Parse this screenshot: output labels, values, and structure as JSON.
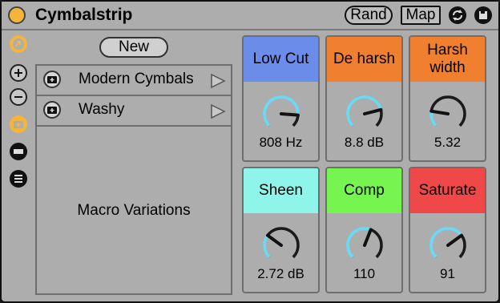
{
  "device": {
    "title": "Cymbalstrip",
    "rand_label": "Rand",
    "map_label": "Map",
    "power_color": "#f5b53a",
    "accent_color": "#f5b53a"
  },
  "sidebar": {
    "icons": [
      "hot-swap-icon",
      "add-icon",
      "remove-icon",
      "snapshot-icon",
      "variation-icon",
      "list-icon"
    ]
  },
  "variations": {
    "new_label": "New",
    "panel_label": "Macro Variations",
    "items": [
      {
        "label": "Modern Cymbals"
      },
      {
        "label": "Washy"
      }
    ]
  },
  "macros": [
    {
      "name": "Low Cut",
      "value": "808 Hz",
      "color": "#6b8ce8",
      "fraction": 0.85
    },
    {
      "name": "De harsh",
      "value": "8.8 dB",
      "color": "#f08030",
      "fraction": 0.78
    },
    {
      "name": "Harsh width",
      "value": "5.32",
      "color": "#f08030",
      "fraction": 0.2
    },
    {
      "name": "Sheen",
      "value": "2.72 dB",
      "color": "#8ff5ea",
      "fraction": 0.3
    },
    {
      "name": "Comp",
      "value": "110",
      "color": "#76f450",
      "fraction": 0.58
    },
    {
      "name": "Saturate",
      "value": "91",
      "color": "#f04848",
      "fraction": 0.7
    }
  ]
}
